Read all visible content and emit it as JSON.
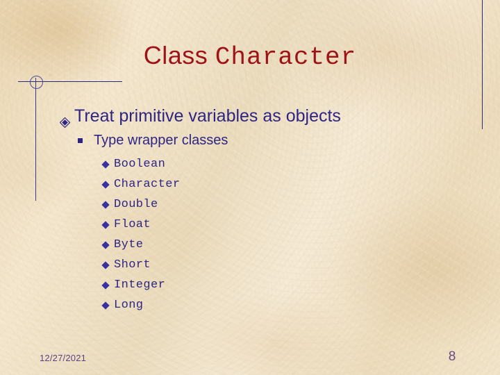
{
  "slide": {
    "title": {
      "part_sans": "Class ",
      "part_mono": "Character",
      "color": "#9e1318"
    },
    "decorations": {
      "line_color": "#2f2483",
      "circle_icon": "ring-outline"
    },
    "content": {
      "level1": [
        {
          "bullet": "diamond-bullet-icon",
          "text": "Treat primitive variables as objects",
          "level2": [
            {
              "bullet": "square-bullet-icon",
              "text": "Type wrapper classes",
              "level3": [
                {
                  "bullet": "small-diamond-bullet-icon",
                  "text": "Boolean"
                },
                {
                  "bullet": "small-diamond-bullet-icon",
                  "text": "Character"
                },
                {
                  "bullet": "small-diamond-bullet-icon",
                  "text": "Double"
                },
                {
                  "bullet": "small-diamond-bullet-icon",
                  "text": "Float"
                },
                {
                  "bullet": "small-diamond-bullet-icon",
                  "text": "Byte"
                },
                {
                  "bullet": "small-diamond-bullet-icon",
                  "text": "Short"
                },
                {
                  "bullet": "small-diamond-bullet-icon",
                  "text": "Integer"
                },
                {
                  "bullet": "small-diamond-bullet-icon",
                  "text": "Long"
                }
              ]
            }
          ]
        }
      ]
    },
    "footer": {
      "date": "12/27/2021",
      "page_number": "8",
      "text_color": "#5b3f82"
    },
    "body_text_color": "#2f2483"
  }
}
